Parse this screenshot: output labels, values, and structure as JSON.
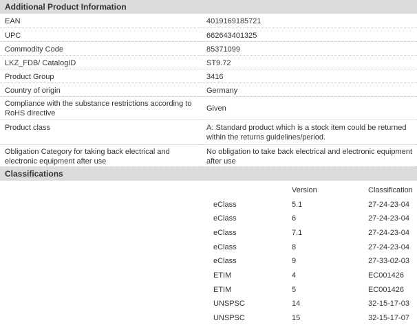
{
  "additional_info": {
    "title": "Additional Product Information",
    "rows": [
      {
        "label": "EAN",
        "value": "4019169185721"
      },
      {
        "label": "UPC",
        "value": "662643401325"
      },
      {
        "label": "Commodity Code",
        "value": "85371099"
      },
      {
        "label": "LKZ_FDB/ CatalogID",
        "value": "ST9.72"
      },
      {
        "label": "Product Group",
        "value": "3416"
      },
      {
        "label": "Country of origin",
        "value": "Germany"
      },
      {
        "label": "Compliance with the substance restrictions according to RoHS directive",
        "value": "Given"
      },
      {
        "label": "Product class",
        "value": "A: Standard product which is a stock item could be returned within the returns guidelines/period."
      },
      {
        "label": "Obligation Category for taking back electrical and electronic equipment after use",
        "value": "No obligation to take back electrical and electronic equipment after use"
      }
    ]
  },
  "classifications": {
    "title": "Classifications",
    "headers": {
      "name": "",
      "version": "Version",
      "classification": "Classification"
    },
    "rows": [
      {
        "name": "eClass",
        "version": "5.1",
        "classification": "27-24-23-04"
      },
      {
        "name": "eClass",
        "version": "6",
        "classification": "27-24-23-04"
      },
      {
        "name": "eClass",
        "version": "7.1",
        "classification": "27-24-23-04"
      },
      {
        "name": "eClass",
        "version": "8",
        "classification": "27-24-23-04"
      },
      {
        "name": "eClass",
        "version": "9",
        "classification": "27-33-02-03"
      },
      {
        "name": "ETIM",
        "version": "4",
        "classification": "EC001426"
      },
      {
        "name": "ETIM",
        "version": "5",
        "classification": "EC001426"
      },
      {
        "name": "UNSPSC",
        "version": "14",
        "classification": "32-15-17-03"
      },
      {
        "name": "UNSPSC",
        "version": "15",
        "classification": "32-15-17-07"
      }
    ]
  }
}
